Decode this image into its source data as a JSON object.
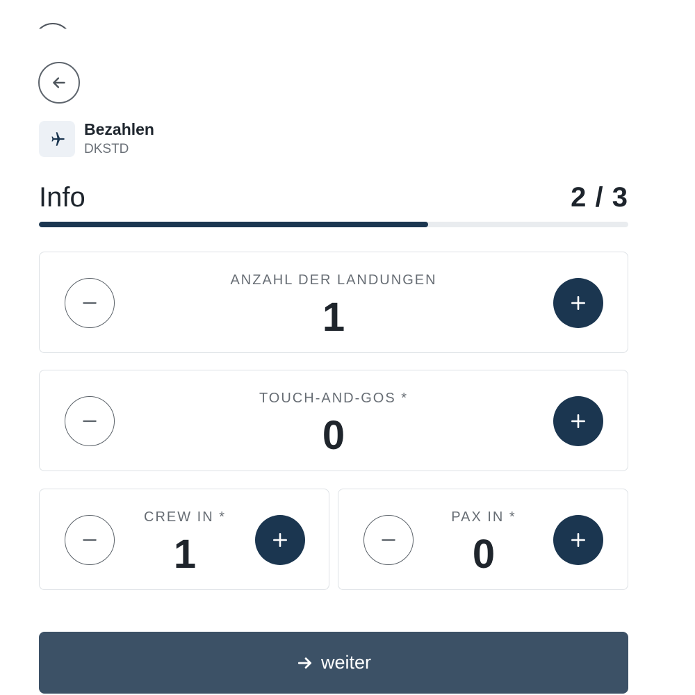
{
  "header": {
    "title": "Bezahlen",
    "subtitle": "DKSTD",
    "back_icon": "arrow-left-icon",
    "badge_icon": "airplane-icon"
  },
  "step": {
    "title": "Info",
    "counter": "2 / 3",
    "progress_fraction": 0.66
  },
  "counters": {
    "landings": {
      "label": "ANZAHL DER LANDUNGEN",
      "value": "1"
    },
    "touch_and_gos": {
      "label": "TOUCH-AND-GOS *",
      "value": "0"
    },
    "crew_in": {
      "label": "CREW IN *",
      "value": "1"
    },
    "pax_in": {
      "label": "PAX IN *",
      "value": "0"
    }
  },
  "submit": {
    "label": "weiter",
    "icon": "arrow-right-icon"
  },
  "colors": {
    "accent": "#1b3650",
    "submit_bg": "#3c5166",
    "progress_track": "#e9ecef"
  }
}
